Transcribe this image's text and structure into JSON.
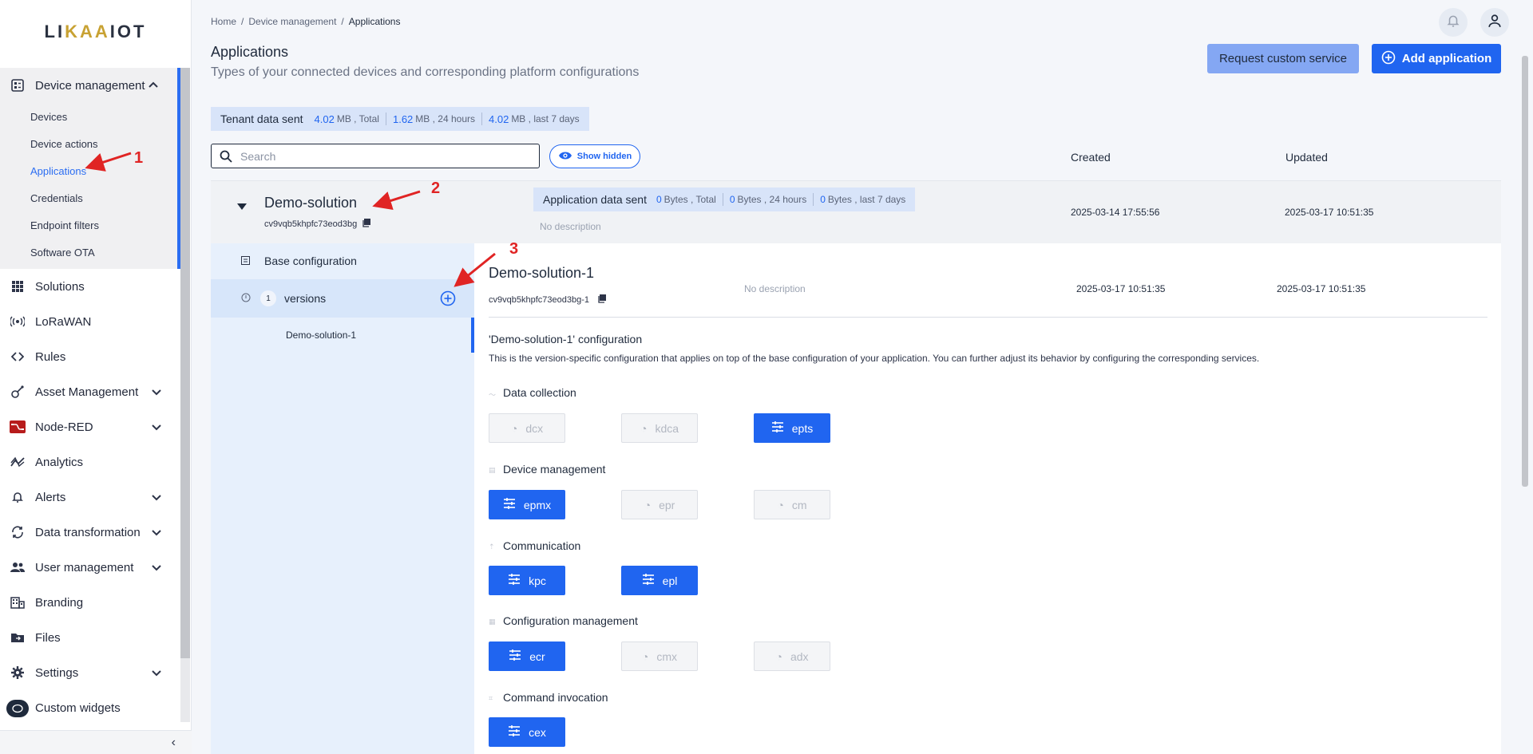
{
  "logo": {
    "text_a": "LI",
    "text_b": "KAA",
    "text_c": "IOT"
  },
  "sidebar": {
    "device_management": {
      "label": "Device management",
      "sub": [
        "Devices",
        "Device actions",
        "Applications",
        "Credentials",
        "Endpoint filters",
        "Software OTA"
      ]
    },
    "items": [
      {
        "label": "Solutions"
      },
      {
        "label": "LoRaWAN"
      },
      {
        "label": "Rules"
      },
      {
        "label": "Asset Management"
      },
      {
        "label": "Node-RED"
      },
      {
        "label": "Analytics"
      },
      {
        "label": "Alerts"
      },
      {
        "label": "Data transformation"
      },
      {
        "label": "User management"
      },
      {
        "label": "Branding"
      },
      {
        "label": "Files"
      },
      {
        "label": "Settings"
      },
      {
        "label": "Custom widgets"
      }
    ],
    "collapse_glyph": "‹"
  },
  "breadcrumb": {
    "home": "Home",
    "section": "Device management",
    "current": "Applications",
    "sep": "/"
  },
  "page": {
    "title": "Applications",
    "subtitle": "Types of your connected devices and corresponding platform configurations",
    "request_button": "Request custom service",
    "add_button": "Add application"
  },
  "tenant_stats": {
    "label": "Tenant data sent",
    "total_value": "4.02",
    "total_unit": "MB , Total",
    "day_value": "1.62",
    "day_unit": "MB , 24 hours",
    "week_value": "4.02",
    "week_unit": "MB , last 7 days"
  },
  "search": {
    "placeholder": "Search"
  },
  "show_hidden": "Show hidden",
  "columns": {
    "created": "Created",
    "updated": "Updated"
  },
  "app": {
    "name": "Demo-solution",
    "id": "cv9vqb5khpfc73eod3bg",
    "stats_label": "Application data sent",
    "total_value": "0",
    "total_unit": "Bytes , Total",
    "day_value": "0",
    "day_unit": "Bytes , 24 hours",
    "week_value": "0",
    "week_unit": "Bytes , last 7 days",
    "description": "No description",
    "created": "2025-03-14 17:55:56",
    "updated": "2025-03-17 10:51:35"
  },
  "left_panel": {
    "base_config": "Base configuration",
    "versions_count": "1",
    "versions_label": "versions",
    "version_item": "Demo-solution-1"
  },
  "version": {
    "title": "Demo-solution-1",
    "id": "cv9vqb5khpfc73eod3bg-1",
    "description": "No description",
    "created": "2025-03-17 10:51:35",
    "updated": "2025-03-17 10:51:35",
    "config_title": "'Demo-solution-1' configuration",
    "config_text": "This is the version-specific configuration that applies on top of the base configuration of your application. You can further adjust its behavior by configuring the corresponding services."
  },
  "sections": [
    {
      "label": "Data collection",
      "services": [
        {
          "name": "dcx",
          "enabled": false
        },
        {
          "name": "kdca",
          "enabled": false
        },
        {
          "name": "epts",
          "enabled": true
        }
      ]
    },
    {
      "label": "Device management",
      "services": [
        {
          "name": "epmx",
          "enabled": true
        },
        {
          "name": "epr",
          "enabled": false
        },
        {
          "name": "cm",
          "enabled": false
        }
      ]
    },
    {
      "label": "Communication",
      "services": [
        {
          "name": "kpc",
          "enabled": true
        },
        {
          "name": "epl",
          "enabled": true
        }
      ]
    },
    {
      "label": "Configuration management",
      "services": [
        {
          "name": "ecr",
          "enabled": true
        },
        {
          "name": "cmx",
          "enabled": false
        },
        {
          "name": "adx",
          "enabled": false
        }
      ]
    },
    {
      "label": "Command invocation",
      "services": [
        {
          "name": "cex",
          "enabled": true
        }
      ]
    }
  ],
  "annotations": {
    "one": "1",
    "two": "2",
    "three": "3"
  },
  "colors": {
    "accent": "#2065f0",
    "annotation": "#e02424"
  }
}
